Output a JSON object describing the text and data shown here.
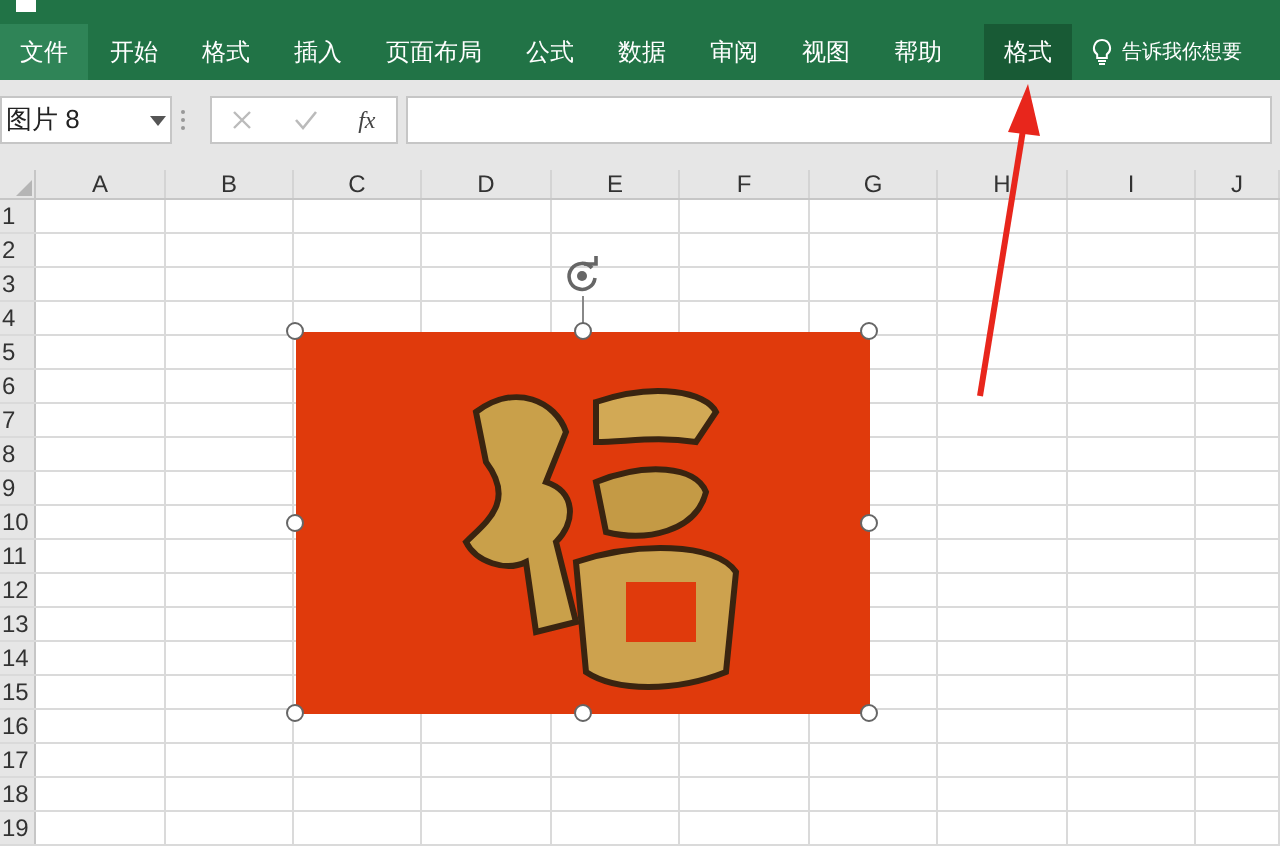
{
  "ribbon": {
    "tabs": [
      {
        "label": "文件",
        "kind": "file",
        "selected": false
      },
      {
        "label": "开始",
        "kind": "tab",
        "selected": false
      },
      {
        "label": "格式",
        "kind": "tab",
        "selected": false
      },
      {
        "label": "插入",
        "kind": "tab",
        "selected": false
      },
      {
        "label": "页面布局",
        "kind": "tab",
        "selected": false
      },
      {
        "label": "公式",
        "kind": "tab",
        "selected": false
      },
      {
        "label": "数据",
        "kind": "tab",
        "selected": false
      },
      {
        "label": "审阅",
        "kind": "tab",
        "selected": false
      },
      {
        "label": "视图",
        "kind": "tab",
        "selected": false
      },
      {
        "label": "帮助",
        "kind": "tab",
        "selected": false
      },
      {
        "label": "格式",
        "kind": "tab",
        "selected": true
      }
    ],
    "tell_me": "告诉我你想要"
  },
  "formula_bar": {
    "name_box": "图片 8",
    "fx": "fx"
  },
  "sheet": {
    "columns": [
      "A",
      "B",
      "C",
      "D",
      "E",
      "F",
      "G",
      "H",
      "I",
      "J"
    ],
    "rows": [
      "1",
      "2",
      "3",
      "4",
      "5",
      "6",
      "7",
      "8",
      "9",
      "10",
      "11",
      "12",
      "13",
      "14",
      "15",
      "16",
      "17",
      "18",
      "19"
    ],
    "image": {
      "kind": "picture",
      "selected": true
    }
  }
}
